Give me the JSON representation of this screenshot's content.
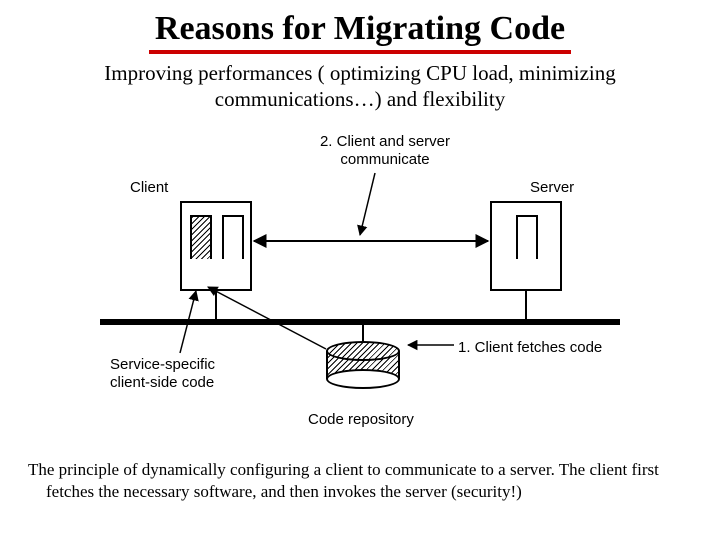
{
  "title": "Reasons for Migrating Code",
  "subtitle": "Improving performances ( optimizing CPU load, minimizing communications…) and flexibility",
  "diagram": {
    "client": "Client",
    "server": "Server",
    "step2": "2. Client and server communicate",
    "step1": "1. Client fetches code",
    "side_code": "Service-specific client-side code",
    "repo": "Code repository"
  },
  "caption": "The principle of dynamically configuring a client to communicate to a server.  The client first fetches the necessary software, and then invokes the server (security!)"
}
